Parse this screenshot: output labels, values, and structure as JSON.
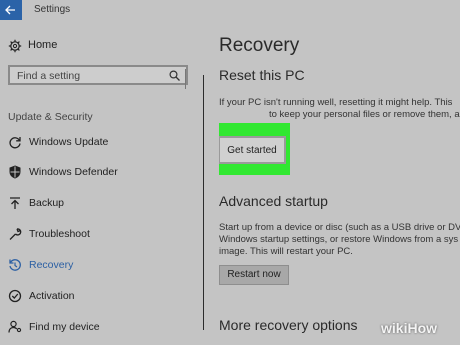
{
  "window": {
    "title": "Settings"
  },
  "sidebar": {
    "home_label": "Home",
    "search_placeholder": "Find a setting",
    "section_label": "Update & Security",
    "items": [
      {
        "label": "Windows Update",
        "icon": "refresh-icon"
      },
      {
        "label": "Windows Defender",
        "icon": "shield-icon"
      },
      {
        "label": "Backup",
        "icon": "backup-arrow-icon"
      },
      {
        "label": "Troubleshoot",
        "icon": "wrench-icon"
      },
      {
        "label": "Recovery",
        "icon": "history-icon",
        "active": true
      },
      {
        "label": "Activation",
        "icon": "check-circle-icon"
      },
      {
        "label": "Find my device",
        "icon": "person-location-icon"
      }
    ]
  },
  "main": {
    "title": "Recovery",
    "reset": {
      "heading": "Reset this PC",
      "text_line1": "If your PC isn't running well, resetting it might help. This",
      "text_line2": "to keep your personal files or remove them, and",
      "button": "Get started"
    },
    "advanced": {
      "heading": "Advanced startup",
      "text_line1": "Start up from a device or disc (such as a USB drive or DV",
      "text_line2": "Windows startup settings, or restore Windows from a sys",
      "text_line3": "image. This will restart your PC.",
      "button": "Restart now"
    },
    "more_heading": "More recovery options"
  },
  "watermark": "wikiHow",
  "colors": {
    "accent": "#2b5fa3",
    "highlight": "#31e831",
    "back_button": "#2b63a8"
  }
}
